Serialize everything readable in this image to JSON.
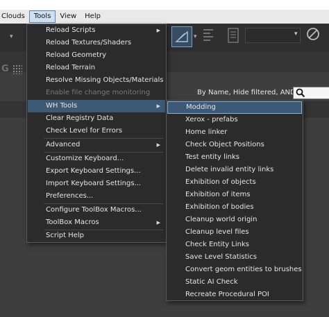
{
  "menubar": {
    "items": [
      {
        "label": "Clouds"
      },
      {
        "label": "Tools"
      },
      {
        "label": "View"
      },
      {
        "label": "Help"
      }
    ]
  },
  "panel": {
    "filter_text": "By Name, Hide filtered, AND"
  },
  "tools_menu": {
    "items": [
      {
        "label": "Reload Scripts",
        "submenu": true
      },
      {
        "label": "Reload Textures/Shaders"
      },
      {
        "label": "Reload Geometry"
      },
      {
        "label": "Reload Terrain"
      },
      {
        "label": "Resolve Missing Objects/Materials"
      },
      {
        "label": "Enable file change monitoring",
        "disabled": true
      },
      {
        "label": "WH Tools",
        "submenu": true,
        "highlighted": true
      },
      {
        "label": "Clear Registry Data"
      },
      {
        "label": "Check Level for Errors"
      },
      {
        "label": "Advanced",
        "submenu": true
      },
      {
        "label": "Customize Keyboard..."
      },
      {
        "label": "Export Keyboard Settings..."
      },
      {
        "label": "Import Keyboard Settings..."
      },
      {
        "label": "Preferences..."
      },
      {
        "label": "Configure ToolBox Macros..."
      },
      {
        "label": "ToolBox Macros",
        "submenu": true
      },
      {
        "label": "Script Help"
      }
    ],
    "submenu_glyph": "▶"
  },
  "wh_tools_menu": {
    "items": [
      {
        "label": "Modding",
        "highlighted": true
      },
      {
        "label": "Xerox - prefabs"
      },
      {
        "label": "Home linker"
      },
      {
        "label": "Check Object Positions"
      },
      {
        "label": "Test entity links"
      },
      {
        "label": "Delete invalid entity links"
      },
      {
        "label": "Exhibition of objects"
      },
      {
        "label": "Exhibition of items"
      },
      {
        "label": "Exhibition of bodies"
      },
      {
        "label": "Cleanup world origin"
      },
      {
        "label": "Cleanup level files"
      },
      {
        "label": "Check Entity Links"
      },
      {
        "label": "Save Level Statistics"
      },
      {
        "label": "Convert geom entities to brushes"
      },
      {
        "label": "Static AI Check"
      },
      {
        "label": "Recreate Procedural POI"
      }
    ]
  },
  "colors": {
    "menu_bg": "#2b2b2b",
    "highlight": "#3c5a75",
    "highlight_border": "#8ab4d8"
  }
}
